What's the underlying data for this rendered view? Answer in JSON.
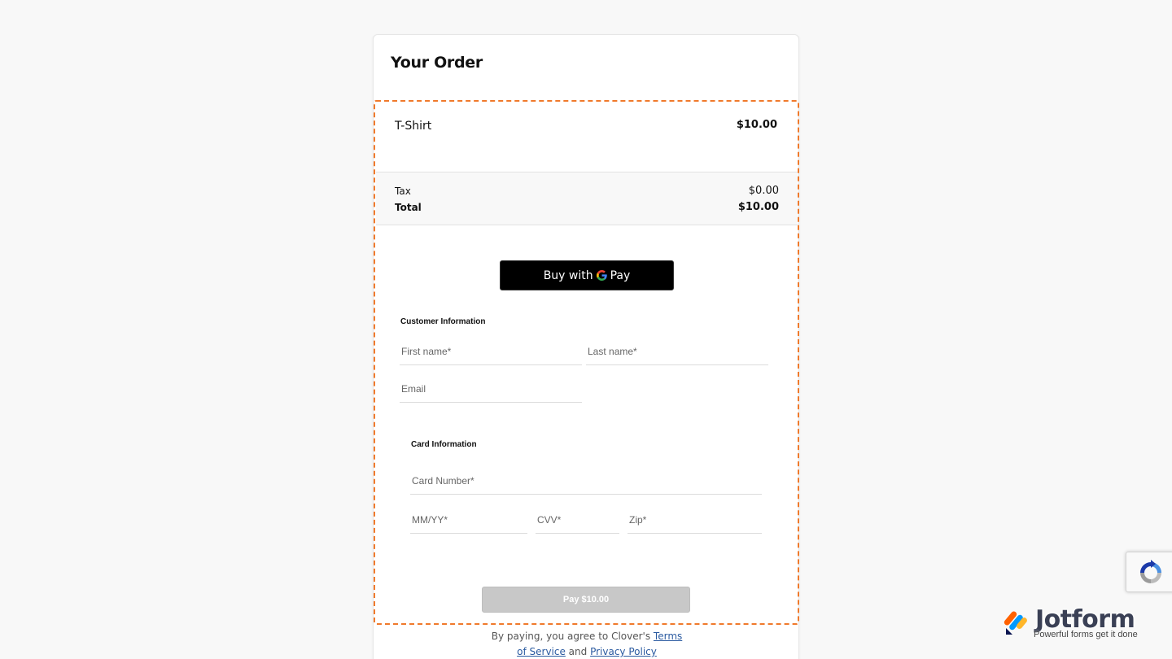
{
  "order": {
    "title": "Your Order",
    "item": {
      "name": "T-Shirt",
      "price": "$10.00"
    },
    "tax_label": "Tax",
    "tax_value": "$0.00",
    "total_label": "Total",
    "total_value": "$10.00"
  },
  "gpay": {
    "prefix": "Buy with",
    "word": "Pay"
  },
  "customer": {
    "section_label": "Customer Information",
    "first_name_placeholder": "First name*",
    "last_name_placeholder": "Last name*",
    "email_placeholder": "Email"
  },
  "card": {
    "section_label": "Card Information",
    "number_placeholder": "Card Number*",
    "expiry_placeholder": "MM/YY*",
    "cvv_placeholder": "CVV*",
    "zip_placeholder": "Zip*"
  },
  "pay_button": "Pay $10.00",
  "legal": {
    "prefix": "By paying, you agree to Clover's ",
    "terms_a": "Terms",
    "terms_b": "of Service",
    "and": " and ",
    "privacy": "Privacy Policy"
  },
  "brand": {
    "name": "Jotform",
    "tagline": "Powerful forms get it done"
  },
  "colors": {
    "accent_dashed": "#f07a2c",
    "gpay_bg": "#000000",
    "pay_disabled": "#c8c8c8",
    "link": "#2a5aa0"
  }
}
